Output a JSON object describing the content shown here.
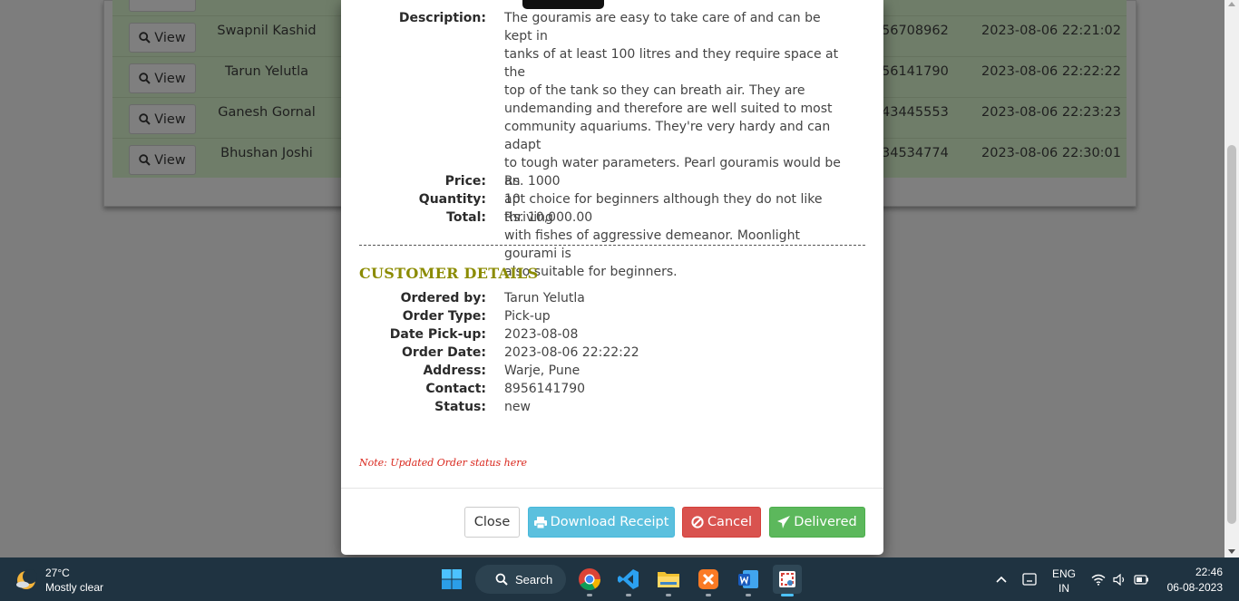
{
  "background": {
    "view_label": "View",
    "rows": [
      {
        "name": "Swapnil Kashid",
        "contact": "56708962",
        "date": "2023-08-06 22:21:02"
      },
      {
        "name": "Tarun Yelutla",
        "contact": "56141790",
        "date": "2023-08-06 22:22:22"
      },
      {
        "name": "Ganesh Gornal",
        "contact": "43445553",
        "date": "2023-08-06 22:23:23"
      },
      {
        "name": "Bhushan Joshi",
        "contact": "34534774",
        "date": "2023-08-06 22:30:01"
      }
    ]
  },
  "product": {
    "description_label": "Description:",
    "description_lines": [
      "The gouramis are easy to take care of and can be kept in",
      "tanks of at least 100 litres and they require space at the",
      "top of the tank so they can breath air. They are",
      "undemanding and therefore are well suited to most",
      "community aquariums. They're very hardy and can adapt",
      "to tough water parameters. Pearl gouramis would be an",
      "apt choice for beginners although they do not like thriving",
      "with fishes of aggressive demeanor. Moonlight gourami is",
      "also suitable for beginners."
    ],
    "price_label": "Price:",
    "price": "Rs. 1000",
    "quantity_label": "Quantity:",
    "quantity": "10",
    "total_label": "Total:",
    "total": "Rs. 10,000.00"
  },
  "customer": {
    "section_title": "CUSTOMER DETAILS",
    "ordered_by_label": "Ordered by:",
    "ordered_by": "Tarun Yelutla",
    "order_type_label": "Order Type:",
    "order_type": "Pick-up",
    "date_pickup_label": "Date Pick-up:",
    "date_pickup": "2023-08-08",
    "order_date_label": "Order Date:",
    "order_date": "2023-08-06 22:22:22",
    "address_label": "Address:",
    "address": "Warje, Pune",
    "contact_label": "Contact:",
    "contact": "8956141790",
    "status_label": "Status:",
    "status": "new"
  },
  "note": "Note: Updated Order status here",
  "footer": {
    "close_label": "Close",
    "receipt_label": "Download Receipt",
    "cancel_label": "Cancel",
    "delivered_label": "Delivered"
  },
  "colors": {
    "section_title": "#8b8b00",
    "note": "#d9261c",
    "info": "#5bc0de",
    "danger": "#d9534f",
    "success": "#5cb85c"
  },
  "taskbar": {
    "temperature": "27°C",
    "weather": "Mostly clear",
    "search_label": "Search",
    "lang_top": "ENG",
    "lang_bottom": "IN",
    "time": "22:46",
    "date": "06-08-2023"
  }
}
